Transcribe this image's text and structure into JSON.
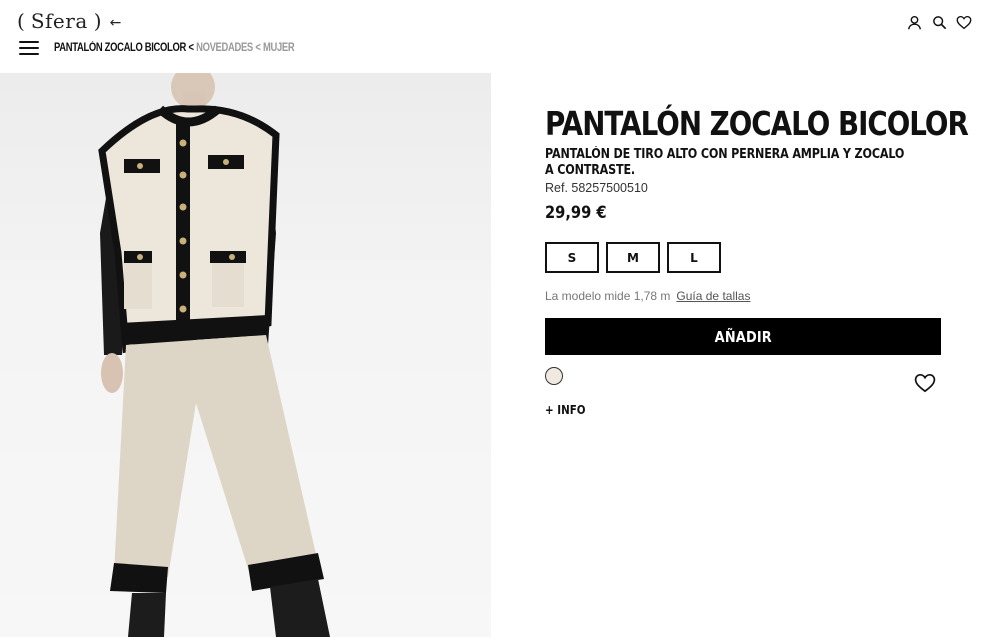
{
  "header": {
    "logo_text": "Sfera",
    "logo_open": "(",
    "logo_close": ")",
    "back_arrow": "←",
    "icons": [
      "user-icon",
      "search-icon",
      "heart-icon"
    ]
  },
  "breadcrumb": {
    "current": "PANTALÓN ZOCALO BICOLOR",
    "separator": "<",
    "links": [
      "NOVEDADES",
      "MUJER"
    ]
  },
  "product": {
    "title": "PANTALÓN ZOCALO BICOLOR",
    "subtitle": "PANTALÓN DE TIRO ALTO CON PERNERA AMPLIA Y ZOCALO A CONTRASTE.",
    "ref": "Ref. 58257500510",
    "price": "29,99 €",
    "sizes": [
      "S",
      "M",
      "L"
    ],
    "model_text": "La modelo mide 1,78 m",
    "size_guide": "Guía de tallas",
    "add_button": "AÑADIR",
    "more_info": "+ INFO",
    "swatch_color": "#efe9e0"
  },
  "colors": {
    "accent": "#000000",
    "muted": "#999999"
  }
}
